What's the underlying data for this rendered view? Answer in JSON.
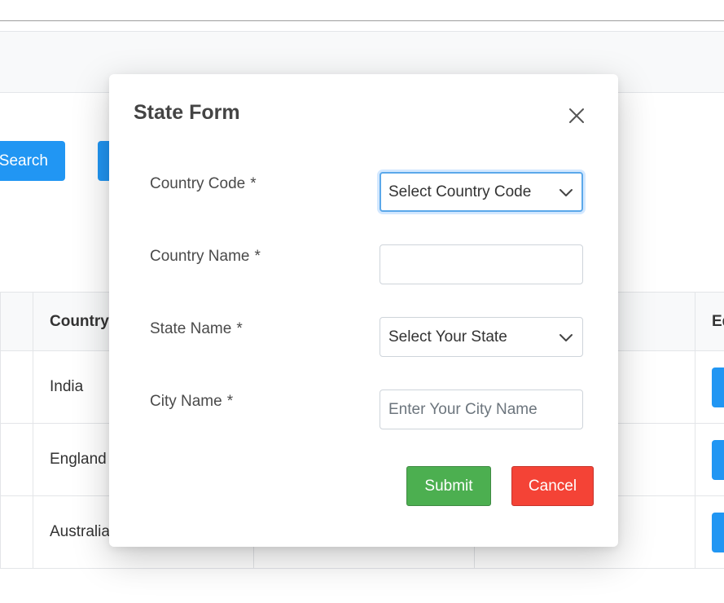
{
  "background": {
    "search_button_label": "Search",
    "table": {
      "headers": [
        "",
        "Country",
        "",
        "",
        "Ed"
      ],
      "rows": [
        [
          "",
          "India",
          "",
          "",
          ""
        ],
        [
          "",
          "England",
          "",
          "",
          ""
        ],
        [
          "",
          "Australia",
          "",
          "",
          ""
        ]
      ]
    }
  },
  "modal": {
    "title": "State Form",
    "fields": {
      "country_code": {
        "label": "Country Code",
        "required_mark": "*",
        "selected": "Select Country Code"
      },
      "country_name": {
        "label": "Country Name",
        "required_mark": "*",
        "value": ""
      },
      "state_name": {
        "label": "State Name",
        "required_mark": "*",
        "selected": "Select Your State"
      },
      "city_name": {
        "label": "City Name",
        "required_mark": "*",
        "placeholder": "Enter Your City Name"
      }
    },
    "buttons": {
      "submit": "Submit",
      "cancel": "Cancel"
    }
  },
  "icons": {
    "close": "close-icon",
    "dropdown": "chevron-down-icon"
  },
  "colors": {
    "primary": "#2196f3",
    "submit": "#4caf50",
    "cancel": "#f44336",
    "focus_ring": "#5ba8ea"
  }
}
